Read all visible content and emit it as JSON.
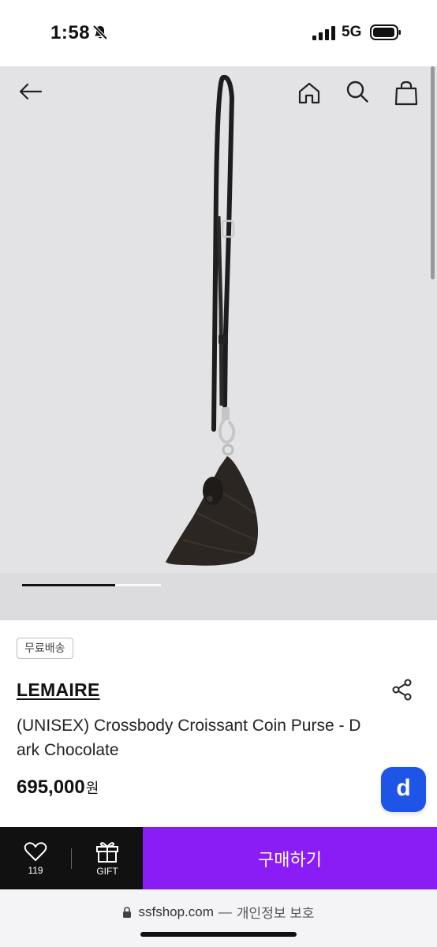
{
  "status_bar": {
    "time": "1:58",
    "network": "5G",
    "icons": [
      "bell-slash-icon",
      "signal-icon",
      "battery-icon"
    ]
  },
  "header": {
    "icons": [
      "back-arrow-icon",
      "home-icon",
      "search-icon",
      "shopping-bag-icon"
    ]
  },
  "gallery": {
    "pager_progress": 0.67
  },
  "product": {
    "badge": "무료배송",
    "brand": "LEMAIRE",
    "name": "(UNISEX) Crossbody Croissant Coin Purse - Dark Chocolate",
    "price": "695,000",
    "currency": "원",
    "share_icon": "share-icon",
    "app_badge_letter": "d",
    "app_badge_color": "#1f55e6"
  },
  "action_bar": {
    "like_count": "119",
    "gift_label": "GIFT",
    "buy_label": "구매하기",
    "buy_color": "#8a1cf6"
  },
  "browser": {
    "host": "ssfshop.com",
    "separator": "—",
    "privacy_label": "개인정보 보호"
  }
}
